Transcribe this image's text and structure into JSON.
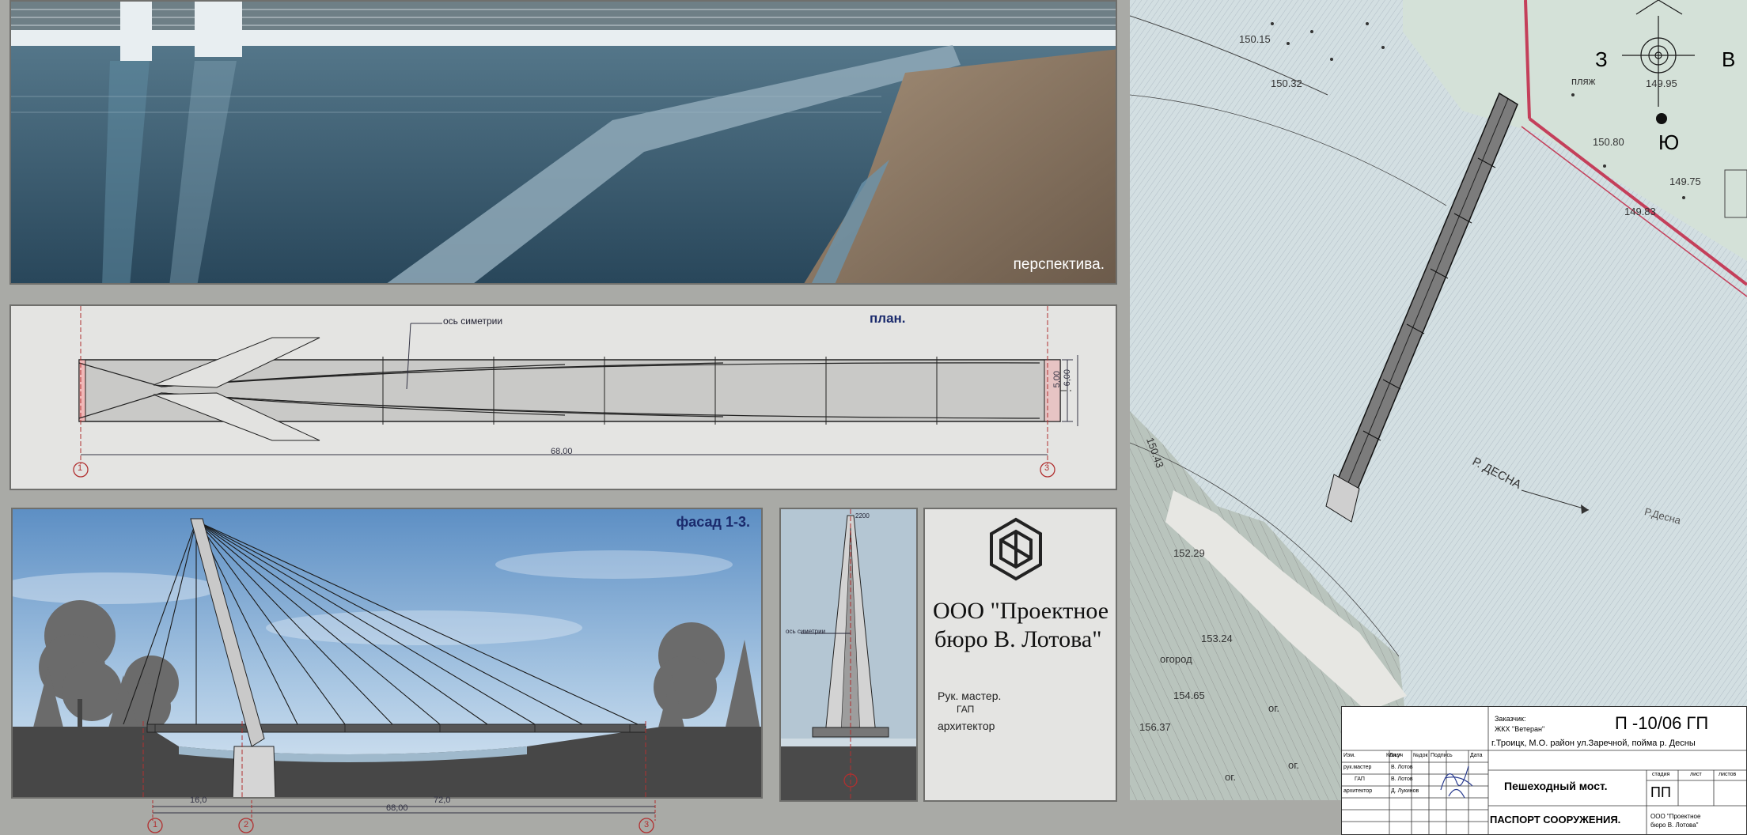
{
  "perspective": {
    "caption": "перспектива."
  },
  "plan": {
    "title": "план.",
    "axis_note": "ось симетрии",
    "dim_total": "68,00",
    "dim_width_inner": "5,00",
    "dim_width_outer": "6,00",
    "axis_left": "1",
    "axis_right": "3"
  },
  "facade": {
    "title": "фасад 1-3.",
    "dim_total": "68,00",
    "dim_left": "16,0",
    "dim_right": "72,0",
    "axes": [
      "1",
      "2",
      "3"
    ]
  },
  "section": {
    "axis_note": "ось симетрии",
    "dim_top": "2200"
  },
  "company": {
    "name_line1": "ООО \"Проектное",
    "name_line2": "бюро В. Лотова\"",
    "role_master": "Рук. мастер.",
    "role_gap": "ГАП",
    "role_architect": "архитектор"
  },
  "map": {
    "compass": {
      "west": "З",
      "east": "В",
      "south": "Ю"
    },
    "river_label": "Р. ДЕСНА",
    "river_label_2": "Р.Десна",
    "beach": "пляж",
    "garden": "огород",
    "elevations": [
      "150.15",
      "150.32",
      "149.95",
      "150.80",
      "149.75",
      "149.83",
      "150.43",
      "152.29",
      "153.24",
      "154.65",
      "156.37"
    ],
    "og_marks": [
      "ог.",
      "ог.",
      "ог."
    ]
  },
  "stamp": {
    "customer_label": "Заказчик:",
    "customer": "ЖКХ \"Ветеран\"",
    "code": "П -10/06 ГП",
    "address": "г.Троицк, М.О. район ул.Заречной, пойма р. Десны",
    "col_headers": [
      "Изм.",
      "Кол.уч",
      "Лист",
      "№док",
      "Подпись",
      "Дата"
    ],
    "rows": [
      {
        "role": "рук.мастер",
        "name": "В. Лотов"
      },
      {
        "role": "ГАП",
        "name": "В. Лотов"
      },
      {
        "role": "архитектор",
        "name": "Д. Лукинов"
      }
    ],
    "object_name": "Пешеходный мост.",
    "stage_headers": [
      "стадия",
      "лист",
      "листов"
    ],
    "stage": "ПП",
    "doc_title": "ПАСПОРТ СООРУЖЕНИЯ.",
    "firm": "ООО \"Проектное бюро В. Лотова\""
  }
}
